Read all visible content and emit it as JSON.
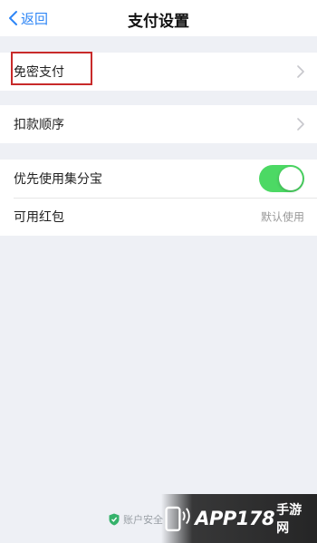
{
  "navbar": {
    "back_label": "返回",
    "title": "支付设置"
  },
  "groups": [
    {
      "rows": [
        {
          "label": "免密支付"
        }
      ]
    },
    {
      "rows": [
        {
          "label": "扣款顺序"
        }
      ]
    },
    {
      "rows": [
        {
          "label": "优先使用集分宝",
          "toggle": "on"
        },
        {
          "label": "可用红包",
          "value": "默认使用"
        }
      ]
    }
  ],
  "footer": {
    "note": "账户安全"
  },
  "watermark": {
    "brand": "APP178",
    "suffix": "手游网"
  },
  "colors": {
    "accent": "#2e86f6",
    "toggle_on": "#4cd964",
    "highlight": "#c82a2a",
    "background": "#eef0f5"
  }
}
